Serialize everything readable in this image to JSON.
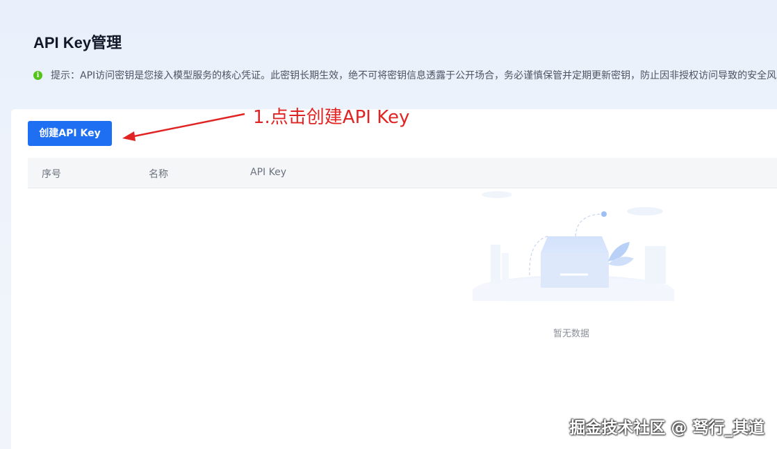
{
  "header": {
    "title": "API Key管理",
    "tip_icon": "info-icon",
    "tip_text": "提示：API访问密钥是您接入模型服务的核心凭证。此密钥长期生效，绝不可将密钥信息透露于公开场合，务必谨慎保管并定期更新密钥，防止因非授权访问导致的安全风险。"
  },
  "toolbar": {
    "create_label": "创建API Key"
  },
  "annotation": {
    "text": "1.点击创建API Key",
    "color": "#e02424"
  },
  "table": {
    "columns": [
      "序号",
      "名称",
      "API Key"
    ],
    "rows": [],
    "empty_text": "暂无数据"
  },
  "watermark": "掘金技术社区 @ 驽行_其道",
  "colors": {
    "primary": "#1f6ff2",
    "success": "#52c41a"
  }
}
